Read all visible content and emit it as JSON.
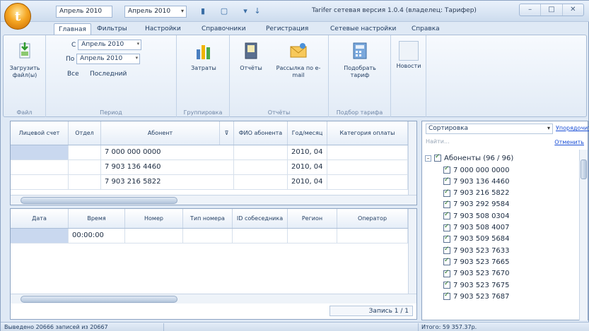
{
  "titlebar": {
    "qa_from": "Апрель 2010",
    "qa_to": "Апрель 2010",
    "title": "Tarifer сетевая версия 1.0.4 (владелец: Тарифер)"
  },
  "tabs": [
    "Главная",
    "Фильтры",
    "Настройки",
    "Справочники",
    "Регистрация",
    "Сетевые настройки",
    "Справка"
  ],
  "ribbon": {
    "file": {
      "button": "Загрузить файл(ы)",
      "group": "Файл"
    },
    "period": {
      "from_prefix": "С",
      "from_value": "Апрель 2010",
      "to_prefix": "По",
      "to_value": "Апрель 2010",
      "all": "Все",
      "last": "Последний",
      "group": "Период"
    },
    "groupings": {
      "button": "Затраты",
      "group": "Группировка"
    },
    "reports": {
      "reports_button": "Отчёты",
      "mailing_button": "Рассылка по e-mail",
      "group": "Отчёты"
    },
    "tariff": {
      "button": "Подобрать тариф",
      "group": "Подбор тарифа"
    },
    "news": {
      "button": "Новости"
    }
  },
  "top_table": {
    "columns": [
      "Лицевой счет",
      "Отдел",
      "Абонент",
      "",
      "ФИО абонента",
      "Год/месяц",
      "Категория оплаты"
    ],
    "rows": [
      [
        "",
        "",
        "7 000 000 0000",
        "",
        "",
        "2010, 04",
        ""
      ],
      [
        "",
        "",
        "7 903 136 4460",
        "",
        "",
        "2010, 04",
        ""
      ],
      [
        "",
        "",
        "7 903 216 5822",
        "",
        "",
        "2010, 04",
        ""
      ]
    ]
  },
  "bottom_table": {
    "columns": [
      "Дата",
      "Время",
      "Номер",
      "Тип номера",
      "ID собеседника",
      "Регион",
      "Оператор"
    ],
    "rows": [
      [
        "",
        "00:00:00",
        "",
        "",
        "",
        "",
        ""
      ]
    ],
    "record_label": "Запись 1 / 1"
  },
  "right_panel": {
    "sort_label": "Сортировка",
    "sort_link": "Упорядочить по...",
    "find_placeholder": "Найти...",
    "mark_link": "Отменить",
    "root": "Абоненты (96 / 96)",
    "items": [
      "7 000 000 0000",
      "7 903 136 4460",
      "7 903 216 5822",
      "7 903 292 9584",
      "7 903 508 0304",
      "7 903 508 4007",
      "7 903 509 5684",
      "7 903 523 7633",
      "7 903 523 7665",
      "7 903 523 7670",
      "7 903 523 7675",
      "7 903 523 7687"
    ]
  },
  "statusbar": {
    "left": "Выведено 20666 записей из 20667",
    "right": "Итого: 59 357.37р."
  }
}
